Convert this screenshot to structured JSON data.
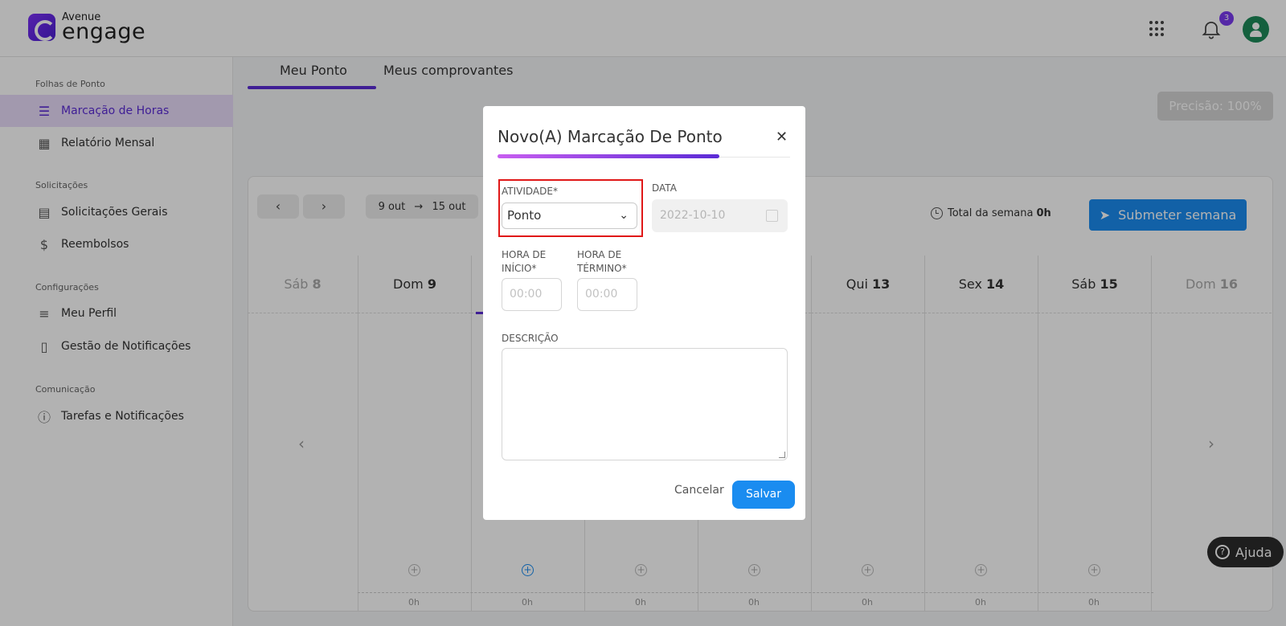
{
  "header": {
    "logo_small": "Avenue",
    "logo_big": "engage",
    "notification_count": "3"
  },
  "sidebar": {
    "sections": [
      {
        "title": "Folhas de Ponto",
        "items": [
          {
            "label": "Marcação de Horas",
            "icon": "list-icon",
            "active": true
          },
          {
            "label": "Relatório Mensal",
            "icon": "calendar-icon"
          }
        ]
      },
      {
        "title": "Solicitações",
        "items": [
          {
            "label": "Solicitações Gerais",
            "icon": "form-icon"
          },
          {
            "label": "Reembolsos",
            "icon": "dollar-icon"
          }
        ]
      },
      {
        "title": "Configurações",
        "items": [
          {
            "label": "Meu Perfil",
            "icon": "menu-icon"
          },
          {
            "label": "Gestão de Notificações",
            "icon": "document-icon"
          }
        ]
      },
      {
        "title": "Comunicação",
        "items": [
          {
            "label": "Tarefas e Notificações",
            "icon": "info-icon"
          }
        ]
      }
    ]
  },
  "tabs": [
    {
      "label": "Meu Ponto",
      "active": true
    },
    {
      "label": "Meus comprovantes"
    }
  ],
  "precision": "Precisão: 100%",
  "week": {
    "range_start": "9 out",
    "range_end": "15 out",
    "total_label": "Total da semana",
    "total_value": "0h",
    "submit_label": "Submeter semana",
    "days": [
      {
        "name": "Sáb",
        "num": "8",
        "faded": true
      },
      {
        "name": "Dom",
        "num": "9"
      },
      {
        "name": "Qui",
        "num": "13"
      },
      {
        "name": "Sex",
        "num": "14"
      },
      {
        "name": "Sáb",
        "num": "15"
      },
      {
        "name": "Dom",
        "num": "16",
        "faded": true
      }
    ],
    "hours": [
      "0h",
      "0h",
      "0h",
      "0h",
      "0h",
      "0h",
      "0h"
    ]
  },
  "help_label": "Ajuda",
  "modal": {
    "title": "Novo(A) Marcação De Ponto",
    "activity_label": "ATIVIDADE*",
    "activity_value": "Ponto",
    "date_label": "DATA",
    "date_value": "2022-10-10",
    "start_label_1": "HORA DE",
    "start_label_2": "INÍCIO*",
    "end_label_1": "HORA DE",
    "end_label_2": "TÉRMINO*",
    "start_placeholder": "00:00",
    "end_placeholder": "00:00",
    "description_label": "DESCRIÇÃO",
    "cancel_label": "Cancelar",
    "save_label": "Salvar"
  },
  "colors": {
    "accent": "#5b2bd6",
    "primary_button": "#1a8cf0",
    "highlight_border": "#e01818"
  }
}
